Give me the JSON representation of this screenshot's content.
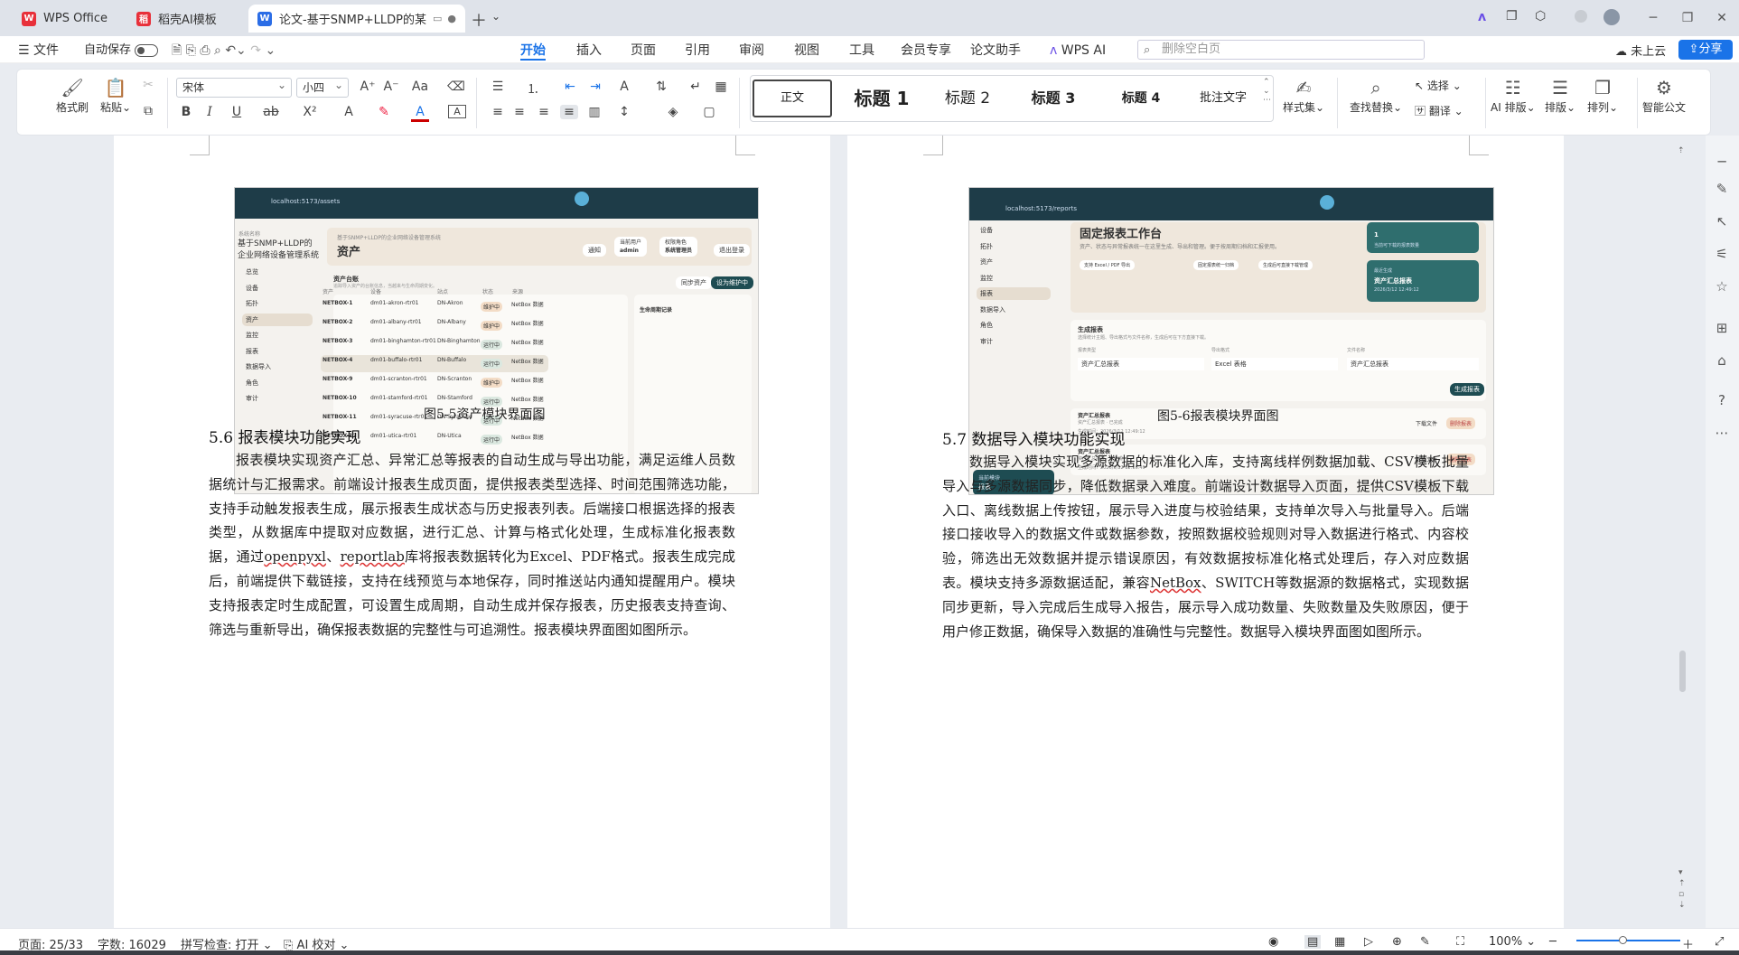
{
  "tabs": [
    {
      "label": "WPS Office"
    },
    {
      "label": "稻壳AI模板"
    },
    {
      "label": "论文-基于SNMP+LLDP的某"
    }
  ],
  "menu": {
    "file": "文件",
    "autosave": "自动保存",
    "items": [
      "开始",
      "插入",
      "页面",
      "引用",
      "审阅",
      "视图",
      "工具",
      "会员专享",
      "论文助手",
      "WPS AI"
    ],
    "search_placeholder": "删除空白页",
    "cloud": "未上云",
    "share": "分享"
  },
  "ribbon": {
    "format_painter": "格式刷",
    "paste": "粘贴",
    "font": "宋体",
    "size": "小四",
    "styles": [
      "正文",
      "标题 1",
      "标题 2",
      "标题 3",
      "标题 4",
      "批注文字"
    ],
    "style_set": "样式集",
    "find_replace": "查找替换",
    "select": "选择",
    "translate": "翻译",
    "ai_layout": "AI 排版",
    "layout": "排版",
    "arrange": "排列",
    "smart_doc": "智能公文"
  },
  "left_page": {
    "caption": "图5-5资产模块界面图",
    "heading": "5.6 报表模块功能实现",
    "body_a": "报表模块实现资产汇总、异常汇总等报表的自动生成与导出功能，满足运维人员数据统计与汇报需求。前端设计报表生成页面，提供报表类型选择、时间范围筛选功能，支持手动触发报表生成，展示报表生成状态与历史报表列表。后端接口根据选择的报表类型，从数据库中提取对应数据，进行汇总、计算与格式化处理，生成标准化报表数据，通过",
    "w1": "openpyxl",
    "sep": "、",
    "w2": "reportlab",
    "body_b": "库将报表数据转化为Excel、PDF格式。报表生成完成后，前端提供下载链接，支持在线预览与本地保存，同时推送站内通知提醒用户。模块支持报表定时生成配置，可设置生成周期，自动生成并保存报表，历史报表支持查询、筛选与重新导出，确保报表数据的完整性与可追溯性。报表模块界面图如图所示。",
    "shot": {
      "url": "localhost:5173/assets",
      "sys": "系统名称",
      "sysname": "基于SNMP+LLDP的企业网络设备管理系统",
      "crumb": "基于SNMP+LLDP的企业网络设备管理系统",
      "title": "资产",
      "notice": "通知",
      "user_l": "当前用户",
      "user": "admin",
      "role_l": "权限角色",
      "role": "系统管理员",
      "logout": "退出登录",
      "nav": [
        "总览",
        "设备",
        "拓扑",
        "资产",
        "监控",
        "报表",
        "数据导入",
        "角色",
        "审计"
      ],
      "ledger": "资产台账",
      "ledger_sub": "追踪导入资产的台账信息，当越来与生命周期变化。",
      "sync": "同步资产",
      "setmaint": "设为维护中",
      "cols": [
        "资产",
        "设备",
        "站点",
        "状态",
        "来源"
      ],
      "rows": [
        [
          "NETBOX-1",
          "dm01-akron-rtr01",
          "DN-Akron",
          "维护中",
          "NetBox 数据"
        ],
        [
          "NETBOX-2",
          "dm01-albany-rtr01",
          "DN-Albany",
          "维护中",
          "NetBox 数据"
        ],
        [
          "NETBOX-3",
          "dm01-binghamton-rtr01",
          "DN-Binghamton",
          "运行中",
          "NetBox 数据"
        ],
        [
          "NETBOX-4",
          "dm01-buffalo-rtr01",
          "DN-Buffalo",
          "运行中",
          "NetBox 数据"
        ],
        [
          "NETBOX-9",
          "dm01-scranton-rtr01",
          "DN-Scranton",
          "维护中",
          "NetBox 数据"
        ],
        [
          "NETBOX-10",
          "dm01-stamford-rtr01",
          "DN-Stamford",
          "运行中",
          "NetBox 数据"
        ],
        [
          "NETBOX-11",
          "dm01-syracuse-rtr01",
          "DN-Syracuse",
          "运行中",
          "NetBox 数据"
        ],
        [
          "NETBOX-12",
          "dm01-utica-rtr01",
          "DN-Utica",
          "运行中",
          "NetBox 数据"
        ]
      ],
      "lifecycle": "生命周期记录"
    }
  },
  "right_page": {
    "caption": "图5-6报表模块界面图",
    "heading": "5.7 数据导入模块功能实现",
    "body_a": "数据导入模块实现多源数据的标准化入库，支持离线样例数据加载、CSV模板批量导入与多源数据同步，降低数据录入难度。前端设计数据导入页面，提供CSV模板下载入口、离线数据上传按钮，展示导入进度与校验结果，支持单次导入与批量导入。后端接口接收导入的数据文件或数据参数，按照数据校验规则对导入数据进行格式、内容校验，筛选出无效数据并提示错误原因，有效数据按标准化格式处理后，存入对应数据表。模块支持多源数据适配，兼容",
    "w1": "NetBox",
    "body_b": "、SWITCH等数据源的数据格式，实现数据同步更新，导入完成后生成导入报告，展示导入成功数量、失败数量及失败原因，便于用户修正数据，确保导入数据的准确性与完整性。数据导入模块界面图如图所示。",
    "shot": {
      "url": "localhost:5173/reports",
      "title": "固定报表工作台",
      "desc": "资产、状态与异常报表统一在这里生成、导出和管理。便于按周期归档和汇报使用。",
      "chips": [
        "支持 Excel / PDF 导出",
        "固定报表统一归档",
        "生成后可直接下载管理"
      ],
      "nav": [
        "设备",
        "拓扑",
        "资产",
        "监控",
        "报表",
        "数据导入",
        "角色",
        "审计"
      ],
      "card1_n": "1",
      "card1_s": "当前可下载的报表数量",
      "card2_l": "最近生成",
      "card2_t": "资产汇总报表",
      "card2_d": "2026/3/12 12:49:12",
      "gen_title": "生成报表",
      "gen_sub": "选择统计主题、导出格式与文件名称，生成后可在下方直接下载。",
      "f1_l": "报表类型",
      "f1": "资产汇总报表",
      "f2_l": "导出格式",
      "f2": "Excel 表格",
      "f3_l": "文件名称",
      "f3": "资产汇总报表",
      "gen_btn": "生成报表",
      "hist": [
        {
          "t": "资产汇总报表",
          "s": "资产汇总报表 · 已完成",
          "d": "生成时间：2026/3/12 12:49:12"
        },
        {
          "t": "资产汇总报表",
          "s": "资产汇总报表 · 已完成",
          "d": "生成时间：2026/3/12 12:16:49"
        }
      ],
      "dl": "下载文件",
      "del": "删除报表",
      "cur_l": "当前模块",
      "cur": "报表"
    }
  },
  "status": {
    "page": "页面: 25/33",
    "words": "字数: 16029",
    "spell": "拼写检查: 打开",
    "ai": "AI 校对",
    "zoom": "100%"
  },
  "colors": {
    "accent": "#1a73e8",
    "teal": "#1e4c52"
  }
}
